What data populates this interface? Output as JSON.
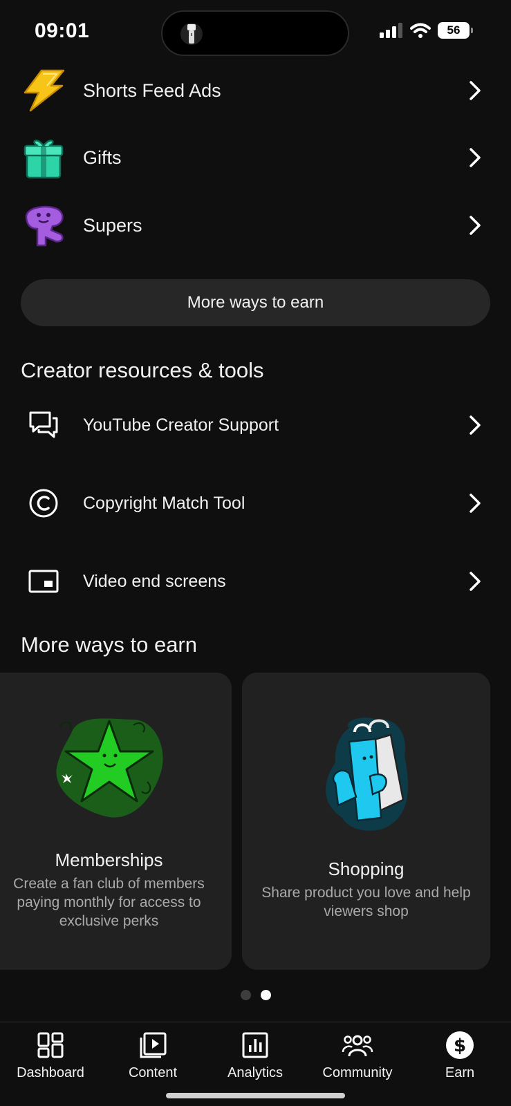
{
  "status": {
    "time": "09:01",
    "battery": "56"
  },
  "earn_items": [
    {
      "label": "Shorts Feed Ads",
      "icon": "lightning-bolt-icon"
    },
    {
      "label": "Gifts",
      "icon": "gift-icon"
    },
    {
      "label": "Supers",
      "icon": "supers-icon"
    }
  ],
  "more_button": "More ways to earn",
  "creator_section": {
    "title": "Creator resources & tools",
    "items": [
      {
        "label": "YouTube Creator Support",
        "icon": "chat-bubbles-icon"
      },
      {
        "label": "Copyright Match Tool",
        "icon": "copyright-icon"
      },
      {
        "label": "Video end screens",
        "icon": "end-screen-icon"
      }
    ]
  },
  "more_section": {
    "title": "More ways to earn",
    "cards": [
      {
        "title": "Memberships",
        "description": "Create a fan club of members paying monthly for access to exclusive perks"
      },
      {
        "title": "Shopping",
        "description": "Share product you love and help viewers shop"
      }
    ],
    "active_page": 2,
    "total_pages": 2
  },
  "bottom_nav": [
    {
      "label": "Dashboard",
      "icon": "dashboard-icon"
    },
    {
      "label": "Content",
      "icon": "content-icon"
    },
    {
      "label": "Analytics",
      "icon": "analytics-icon"
    },
    {
      "label": "Community",
      "icon": "community-icon"
    },
    {
      "label": "Earn",
      "icon": "earn-icon",
      "active": true
    }
  ],
  "colors": {
    "background": "#0f0f0f",
    "surface": "#212121",
    "button": "#272727",
    "text": "#f1f1f1",
    "muted": "#aaaaaa",
    "bolt": "#f7c518",
    "gift": "#2dd4a7",
    "supers": "#a55de0"
  }
}
